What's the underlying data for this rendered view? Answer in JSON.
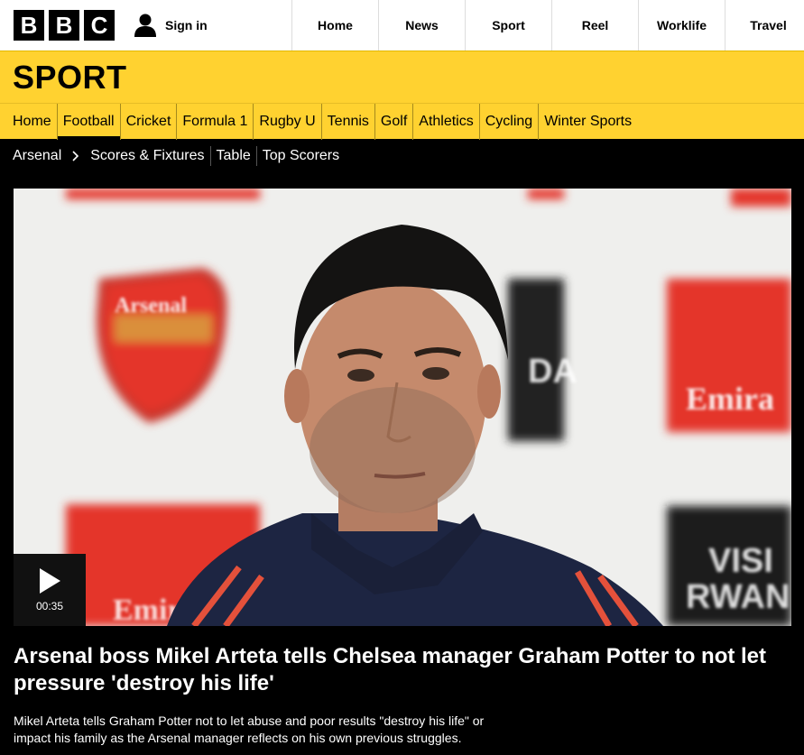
{
  "masthead": {
    "logo_letters": [
      "B",
      "B",
      "C"
    ],
    "signin_label": "Sign in",
    "nav": [
      "Home",
      "News",
      "Sport",
      "Reel",
      "Worklife",
      "Travel"
    ]
  },
  "sport": {
    "title": "SPORT",
    "nav": [
      "Home",
      "Football",
      "Cricket",
      "Formula 1",
      "Rugby U",
      "Tennis",
      "Golf",
      "Athletics",
      "Cycling",
      "Winter Sports"
    ],
    "active": "Football"
  },
  "subnav": {
    "parent": "Arsenal",
    "items": [
      "Scores & Fixtures",
      "Table",
      "Top Scorers"
    ]
  },
  "hero": {
    "duration": "00:35",
    "boards": {
      "arsenal_text": "Arsenal",
      "emirates_text": "Emira",
      "emirates_text_2": "Emir",
      "visit_line1": "VISI",
      "visit_line2": "RWAN",
      "da_text": "DA"
    }
  },
  "article": {
    "headline": "Arsenal boss Mikel Arteta tells Chelsea manager Graham Potter to not let pressure 'destroy his life'",
    "summary": "Mikel Arteta tells Graham Potter not to let abuse and poor results \"destroy his life\" or impact his family as the Arsenal manager reflects on his own previous struggles."
  },
  "colors": {
    "sport_yellow": "#ffd230",
    "arsenal_red": "#e4342a",
    "background": "#000000"
  }
}
